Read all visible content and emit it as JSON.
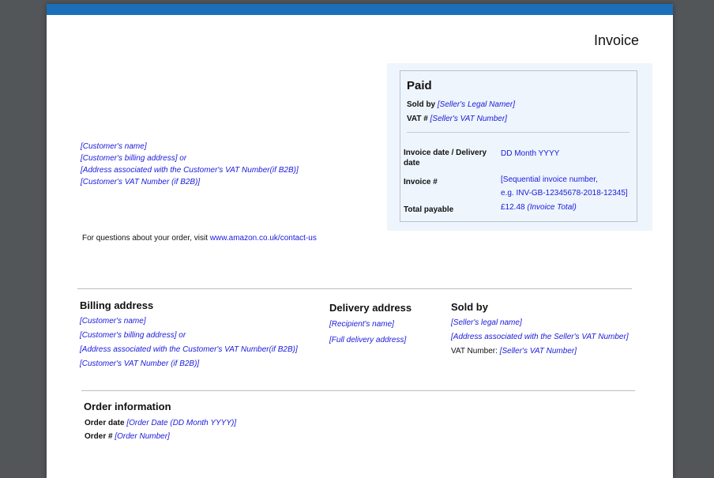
{
  "invoice": {
    "title": "Invoice",
    "panel": {
      "status": "Paid",
      "sold_by_label": "Sold by",
      "sold_by_value": "[Seller's Legal Namer]",
      "vat_label": "VAT #",
      "vat_value": "[Seller's VAT Number]",
      "date_label_line1": "Invoice date / Delivery",
      "date_label_line2": "date",
      "date_value": "DD Month YYYY",
      "number_label": "Invoice #",
      "number_value_line1": "[Sequential invoice number,",
      "number_value_line2": "e.g. INV-GB-12345678-2018-12345]",
      "total_label": "Total payable",
      "total_amount": "£12.48",
      "total_note": "(Invoice Total)"
    },
    "customer_lines": [
      "[Customer's name]",
      "[Customer's billing address] or",
      "[Address associated with the Customer's VAT Number(if B2B)]",
      "[Customer's VAT Number (if B2B)]"
    ],
    "questions_text": "For questions about your order, visit",
    "questions_link": "www.amazon.co.uk/contact-us"
  },
  "billing": {
    "heading": "Billing address",
    "lines": [
      "[Customer's name]",
      "[Customer's billing address] or",
      "[Address associated with the Customer's VAT Number(if B2B)]",
      "[Customer's VAT Number (if B2B)]"
    ]
  },
  "delivery": {
    "heading": "Delivery address",
    "lines": [
      "[Recipient's name]",
      "[Full delivery address]"
    ]
  },
  "seller": {
    "heading": "Sold by",
    "lines": [
      "[Seller's legal name]",
      "[Address associated with the Seller's VAT Number]"
    ],
    "vat_label": "VAT Number:",
    "vat_value": "[Seller's VAT Number]"
  },
  "order": {
    "heading": "Order information",
    "date_label": "Order date",
    "date_value": "[Order Date (DD Month YYYY)]",
    "number_label": "Order #",
    "number_value": "[Order Number]"
  },
  "colors": {
    "accent": "#1b6fb8",
    "link": "#1a1adb",
    "panel": "#eef5fc",
    "viewer_bg": "#525659"
  }
}
